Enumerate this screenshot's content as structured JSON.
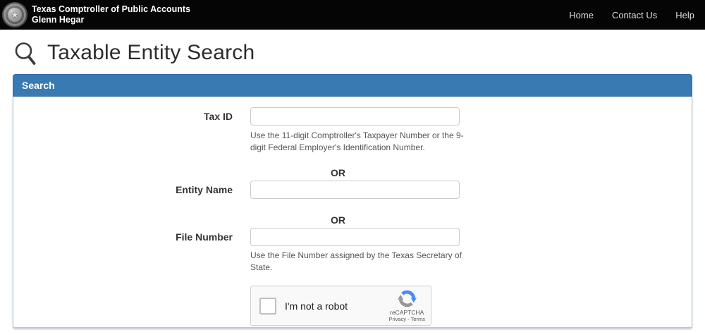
{
  "colors": {
    "header_bg": "#050505",
    "panel_header_bg": "#3a7ab3",
    "panel_header_border": "#2e6da4",
    "panel_body_border": "#aec3da",
    "recaptcha_blue": "#4a8af4",
    "recaptcha_gray": "#989898"
  },
  "header": {
    "org_name": "Texas Comptroller of Public Accounts",
    "officer_name": "Glenn Hegar",
    "nav": [
      {
        "label": "Home"
      },
      {
        "label": "Contact Us"
      },
      {
        "label": "Help"
      }
    ]
  },
  "page": {
    "title": "Taxable Entity Search"
  },
  "search_panel": {
    "title": "Search",
    "or_label": "OR",
    "fields": {
      "tax_id": {
        "label": "Tax ID",
        "value": "",
        "help": "Use the 11-digit Comptroller's Taxpayer Number or the 9-digit Federal Employer's Identification Number."
      },
      "entity_name": {
        "label": "Entity Name",
        "value": ""
      },
      "file_number": {
        "label": "File Number",
        "value": "",
        "help": "Use the File Number assigned by the Texas Secretary of State."
      }
    }
  },
  "recaptcha": {
    "checkbox_label": "I'm not a robot",
    "brand": "reCAPTCHA",
    "privacy_label": "Privacy",
    "separator": "-",
    "terms_label": "Terms"
  }
}
